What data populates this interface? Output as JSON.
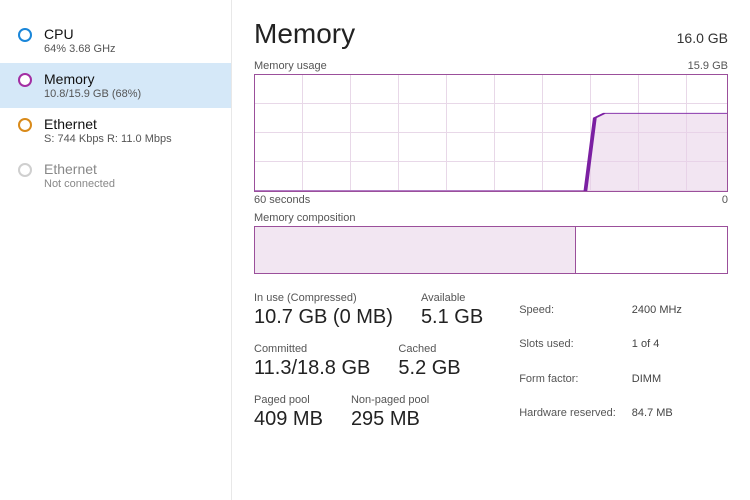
{
  "sidebar": {
    "items": [
      {
        "title": "CPU",
        "sub": "64%  3.68 GHz"
      },
      {
        "title": "Memory",
        "sub": "10.8/15.9 GB (68%)"
      },
      {
        "title": "Ethernet",
        "sub": "S: 744 Kbps  R: 11.0 Mbps"
      },
      {
        "title": "Ethernet",
        "sub": "Not connected"
      }
    ]
  },
  "header": {
    "title": "Memory",
    "capacity": "16.0 GB"
  },
  "usage_chart": {
    "label": "Memory usage",
    "max_label": "15.9 GB",
    "x_left": "60 seconds",
    "x_right": "0"
  },
  "composition": {
    "label": "Memory composition",
    "used_pct": 68
  },
  "stats": {
    "inuse_lbl": "In use (Compressed)",
    "inuse_val": "10.7 GB (0 MB)",
    "avail_lbl": "Available",
    "avail_val": "5.1 GB",
    "committed_lbl": "Committed",
    "committed_val": "11.3/18.8 GB",
    "cached_lbl": "Cached",
    "cached_val": "5.2 GB",
    "paged_lbl": "Paged pool",
    "paged_val": "409 MB",
    "nonpaged_lbl": "Non-paged pool",
    "nonpaged_val": "295 MB"
  },
  "details": {
    "speed_lbl": "Speed:",
    "speed_val": "2400 MHz",
    "slots_lbl": "Slots used:",
    "slots_val": "1 of 4",
    "form_lbl": "Form factor:",
    "form_val": "DIMM",
    "hw_lbl": "Hardware reserved:",
    "hw_val": "84.7 MB"
  },
  "chart_data": {
    "type": "line",
    "title": "Memory usage",
    "ylabel": "GB",
    "ylim": [
      0,
      15.9
    ],
    "x_range_seconds": [
      60,
      0
    ],
    "series": [
      {
        "name": "Memory usage (GB)",
        "x_seconds_ago": [
          60,
          18,
          17,
          16,
          0
        ],
        "values": [
          0.0,
          0.0,
          10.0,
          10.7,
          10.7
        ]
      }
    ]
  }
}
